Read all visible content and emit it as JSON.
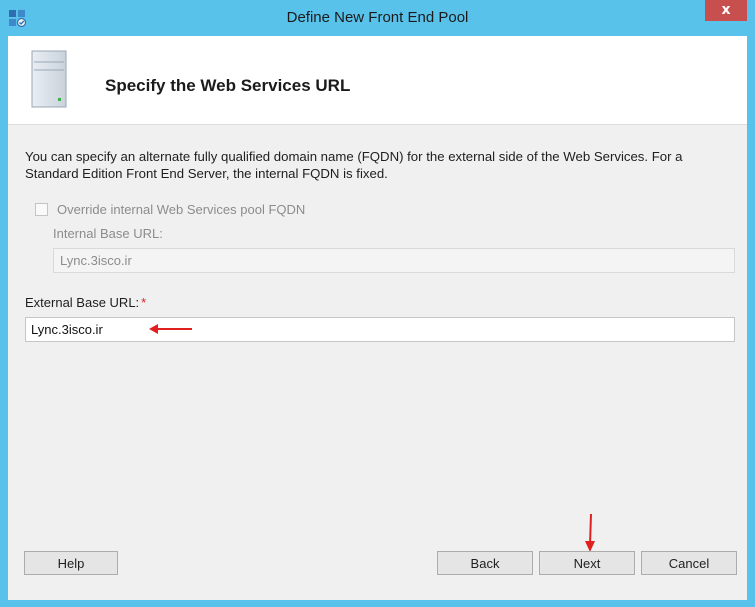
{
  "window": {
    "title": "Define New Front End Pool",
    "close_glyph": "x"
  },
  "header": {
    "title": "Specify the Web Services URL"
  },
  "body": {
    "description": "You can specify an alternate fully qualified domain name (FQDN) for the external side of the Web Services. For a Standard Edition Front End Server, the internal FQDN is fixed.",
    "override_checkbox": {
      "label": "Override internal Web Services pool FQDN",
      "checked": false,
      "enabled": false
    },
    "internal_base_url": {
      "label": "Internal Base URL:",
      "value": "Lync.3isco.ir"
    },
    "external_base_url": {
      "label": "External Base URL:",
      "required_marker": "*",
      "value": "Lync.3isco.ir"
    }
  },
  "buttons": {
    "help": "Help",
    "back": "Back",
    "next": "Next",
    "cancel": "Cancel"
  },
  "colors": {
    "titlebar": "#59c2ea",
    "close": "#c7504f",
    "annotation_arrow": "#e02020"
  }
}
